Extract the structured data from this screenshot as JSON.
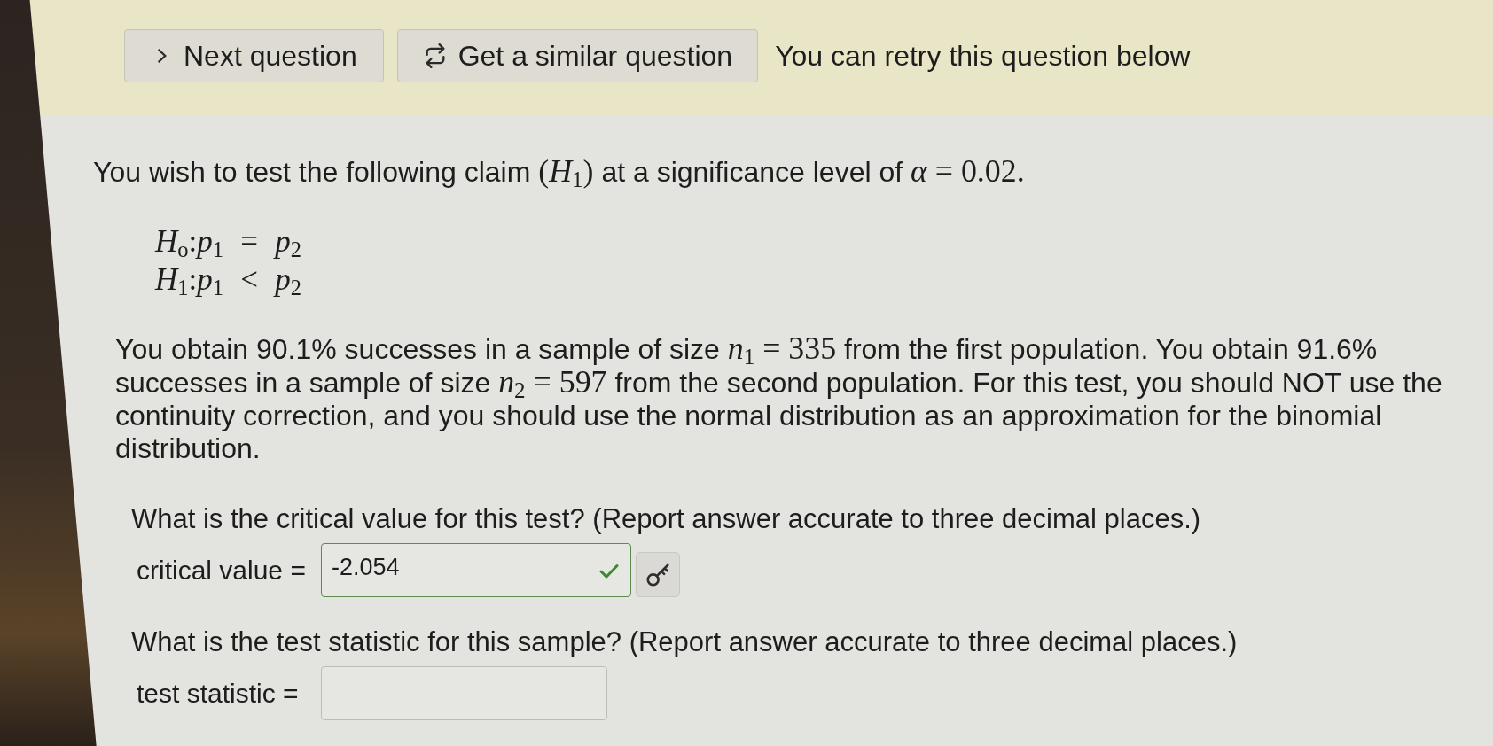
{
  "toolbar": {
    "buttons": [
      {
        "kind": "next",
        "label": "Next question"
      },
      {
        "kind": "similar",
        "label": "Get a similar question"
      }
    ],
    "message": "You can retry this question below"
  },
  "intro": [
    {
      "kind": "text",
      "text": "You wish to test the following claim "
    },
    {
      "kind": "math",
      "text": "(*H*$_{1}$)"
    },
    {
      "kind": "text",
      "text": " at a significance level of "
    },
    {
      "kind": "math",
      "text": "*α* = 0.02."
    }
  ],
  "hypotheses": [
    "*H*$_{o}$:*p*$_{1}$ = *p*$_{2}$",
    "*H*$_{1}$:*p*$_{1}$ < *p*$_{2}$"
  ],
  "problem": [
    {
      "kind": "text",
      "text": "You obtain 90.1% successes in a sample of size "
    },
    {
      "kind": "math",
      "text": "*n*$_{1}$ = 335"
    },
    {
      "kind": "text",
      "text": " from the first population. You obtain 91.6% successes in a sample of size "
    },
    {
      "kind": "math",
      "text": "*n*$_{2}$ = 597"
    },
    {
      "kind": "text",
      "text": " from the second population. For this test, you should NOT use the continuity correction, and you should use the normal distribution as an approximation for the binomial distribution."
    }
  ],
  "parts": [
    {
      "prompt": "What is the critical value for this test? (Report answer accurate to three decimal places.)",
      "label": "critical value =",
      "value": "-2.054",
      "correct": true
    },
    {
      "prompt": "What is the test statistic for this sample? (Report answer accurate to three decimal places.)",
      "label": "test statistic =",
      "correct": false
    }
  ]
}
